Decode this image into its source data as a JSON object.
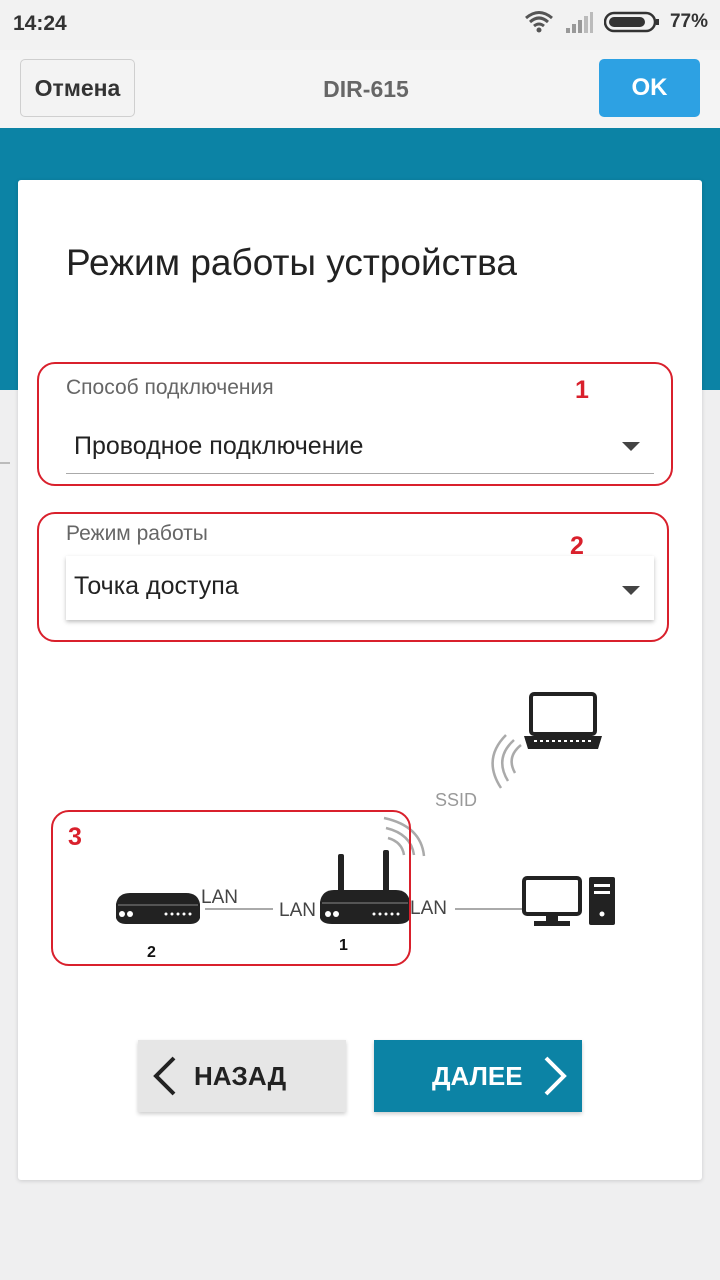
{
  "status_bar": {
    "time": "14:24",
    "battery": "77%"
  },
  "app_bar": {
    "cancel_label": "Отмена",
    "title": "DIR-615",
    "ok_label": "OK"
  },
  "card": {
    "title": "Режим работы устройства"
  },
  "connection_method": {
    "label": "Способ подключения",
    "value": "Проводное подключение"
  },
  "work_mode": {
    "label": "Режим работы",
    "value": "Точка доступа"
  },
  "annotations": {
    "n1": "1",
    "n2": "2",
    "n3": "3"
  },
  "diagram": {
    "ssid": "SSID",
    "lan_left": "LAN",
    "lan_mid": "LAN",
    "lan_right": "LAN",
    "router_1_label": "1",
    "router_2_label": "2"
  },
  "nav": {
    "back_label": "НАЗАД",
    "next_label": "ДАЛЕЕ"
  },
  "colors": {
    "teal": "#0c83a5",
    "ok_blue": "#2da1e3",
    "annotation_red": "#d9202c"
  }
}
